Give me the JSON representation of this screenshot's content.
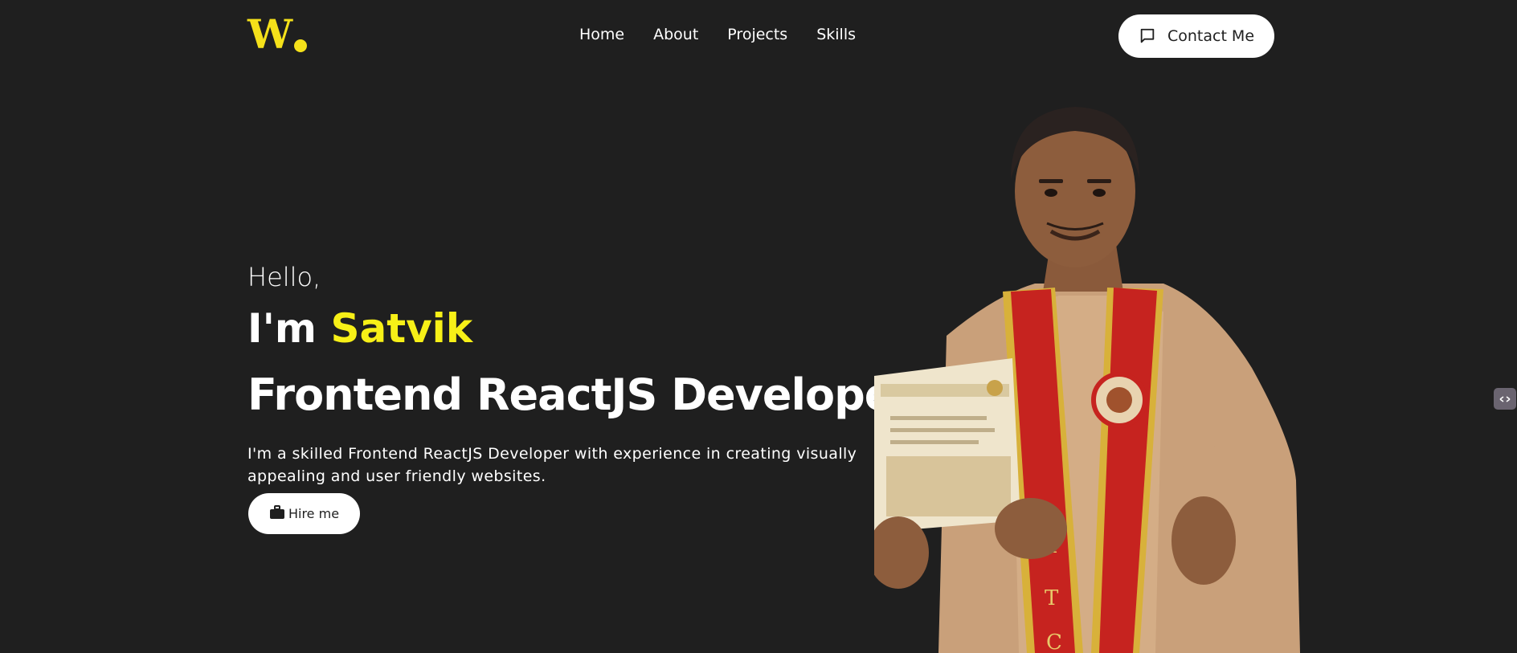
{
  "header": {
    "logo_letter": "W",
    "nav": [
      {
        "label": "Home"
      },
      {
        "label": "About"
      },
      {
        "label": "Projects"
      },
      {
        "label": "Skills"
      }
    ],
    "contact_label": "Contact Me",
    "contact_icon": "message-square-icon"
  },
  "hero": {
    "greeting": "Hello,",
    "intro_prefix": "I'm",
    "name": "Satvik",
    "role": "Frontend ReactJS Developer",
    "description": "I'm a skilled Frontend ReactJS Developer with experience in creating visually appealing and user friendly websites.",
    "hire_label": "Hire me",
    "hire_icon": "briefcase-icon"
  },
  "colors": {
    "background": "#1f1f1f",
    "accent": "#f7f017",
    "button_bg": "#ffffff"
  }
}
